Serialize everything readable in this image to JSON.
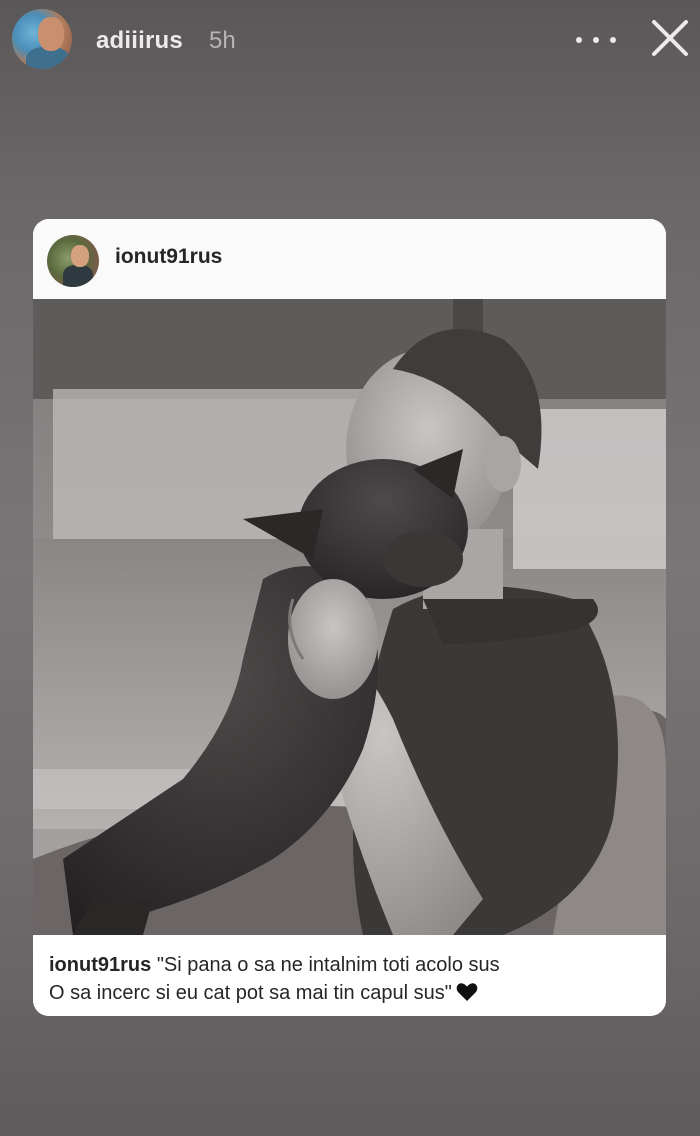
{
  "story": {
    "username": "adiiirus",
    "time": "5h"
  },
  "post": {
    "username": "ionut91rus",
    "caption": {
      "user": "ionut91rus",
      "line1": "\"Si pana o sa ne intalnim toti acolo sus",
      "line2": "O sa incerc si eu cat pot sa mai tin capul sus\"",
      "emoji_icon": "black-heart-icon"
    }
  },
  "icons": {
    "more": "more-options-icon",
    "close": "close-icon"
  },
  "colors": {
    "background": "#6c6869",
    "text_light": "#eceaea",
    "card": "#ffffff",
    "text_dark": "#262626"
  }
}
